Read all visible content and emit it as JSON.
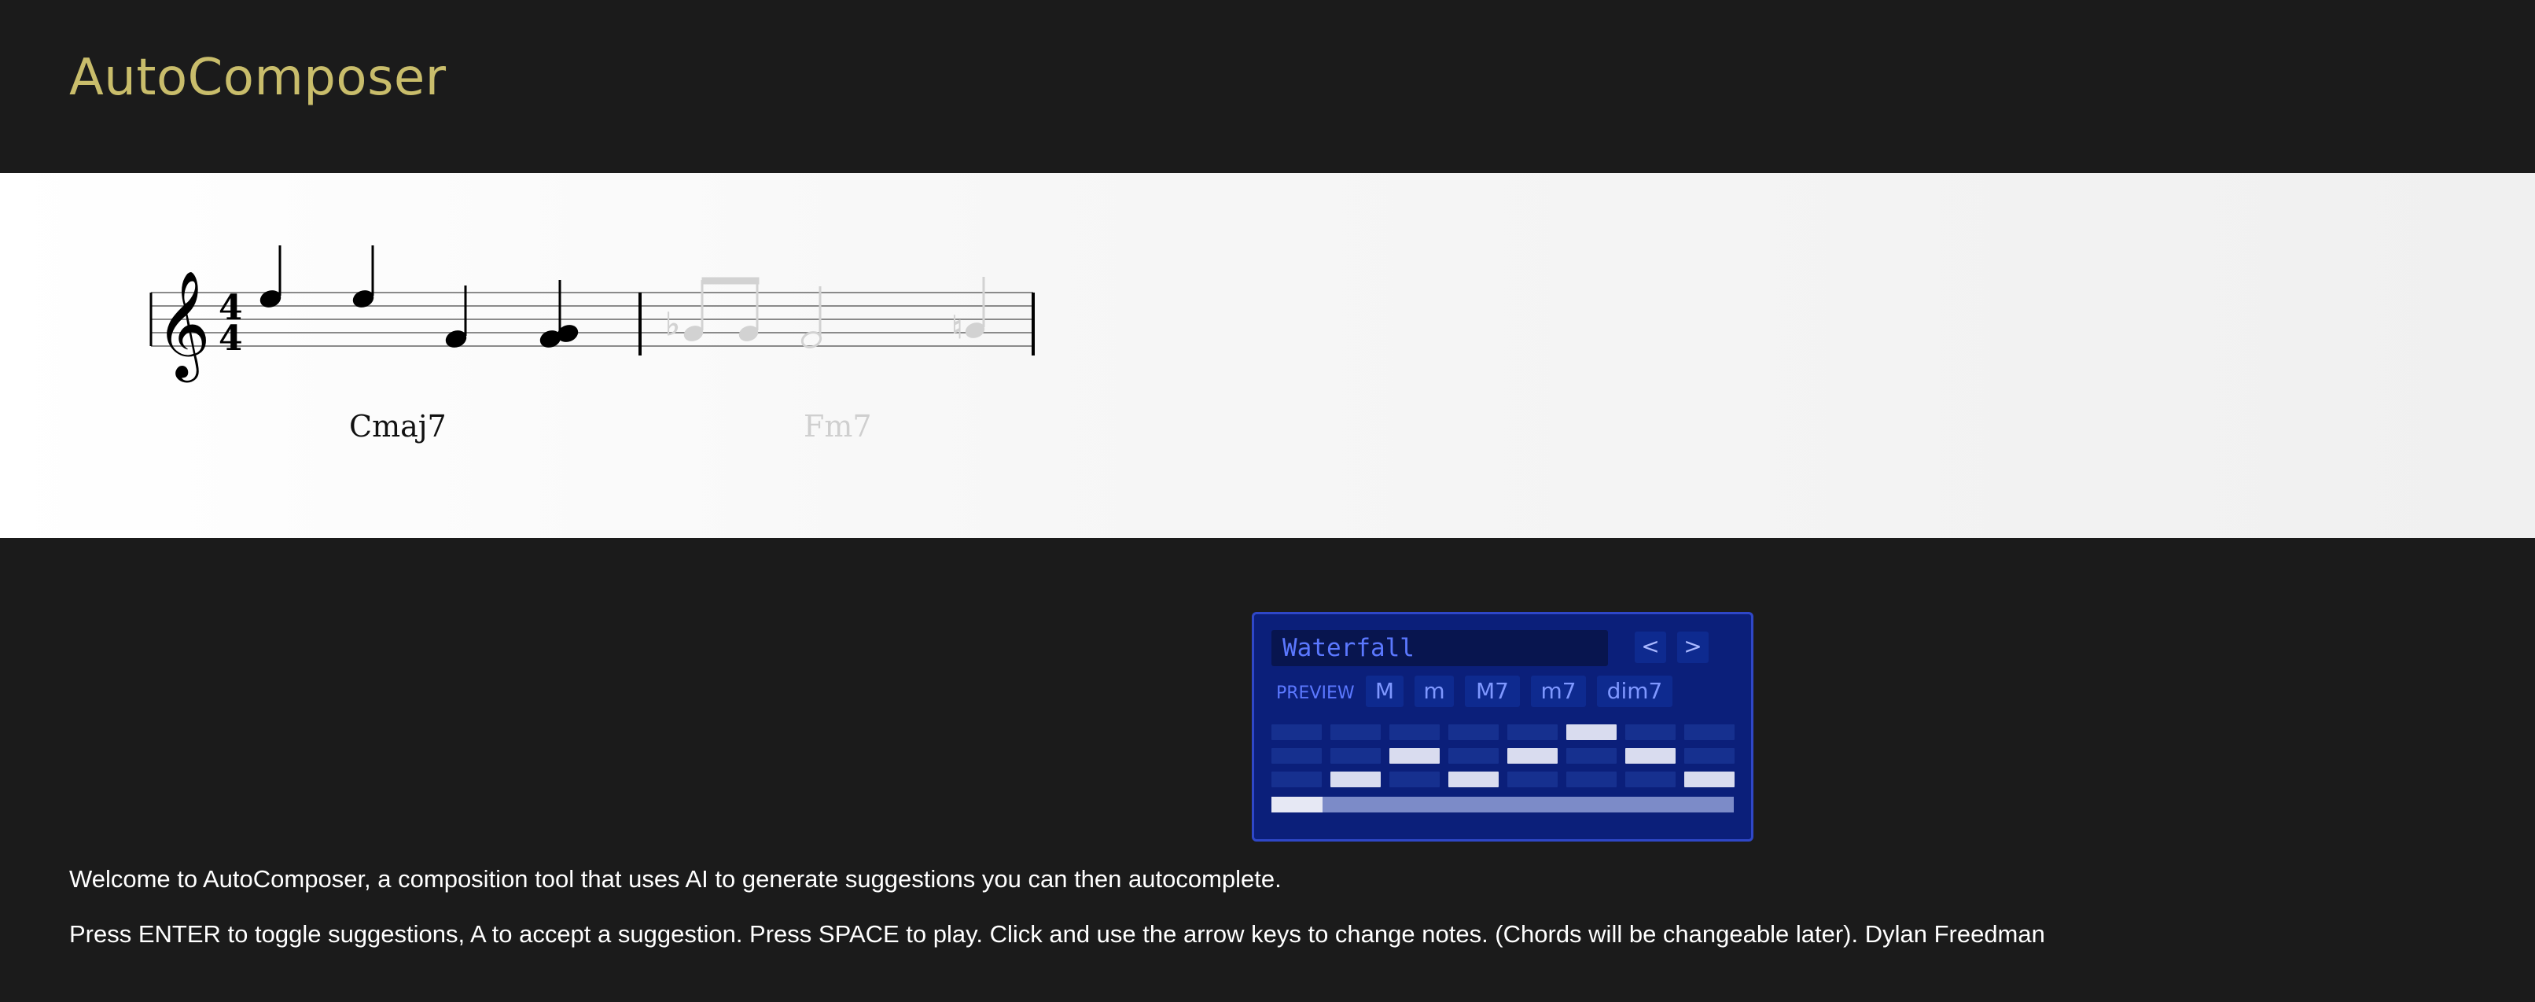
{
  "app": {
    "title": "AutoComposer"
  },
  "score": {
    "time_signature": {
      "top": "4",
      "bottom": "4"
    },
    "measures": [
      {
        "chord": "Cmaj7",
        "suggested": false
      },
      {
        "chord": "Fm7",
        "suggested": true
      }
    ],
    "colors": {
      "notes": "#000000",
      "suggestion": "#cccccc",
      "staff": "#777777"
    }
  },
  "synth": {
    "preset": "Waterfall",
    "prev_label": "<",
    "next_label": ">",
    "preview_label": "PREVIEW",
    "chord_buttons": [
      "M",
      "m",
      "M7",
      "m7",
      "dim7"
    ],
    "grid": {
      "rows": 3,
      "cols": 8,
      "active": [
        [
          0,
          5
        ],
        [
          1,
          2
        ],
        [
          1,
          4
        ],
        [
          1,
          6
        ],
        [
          2,
          1
        ],
        [
          2,
          3
        ],
        [
          2,
          7
        ]
      ]
    },
    "progress": 0.11,
    "colors": {
      "panel": "#0b1f7a",
      "border": "#2f47c8",
      "text": "#5b78ff",
      "cell_on": "#d9dcef"
    }
  },
  "footer": {
    "welcome": "Welcome to AutoComposer, a composition tool that uses AI to generate suggestions you can then autocomplete.",
    "instructions": "Press ENTER to toggle suggestions, A to accept a suggestion. Press SPACE to play. Click and use the arrow keys to change notes. (Chords will be changeable later). Dylan Freedman"
  }
}
